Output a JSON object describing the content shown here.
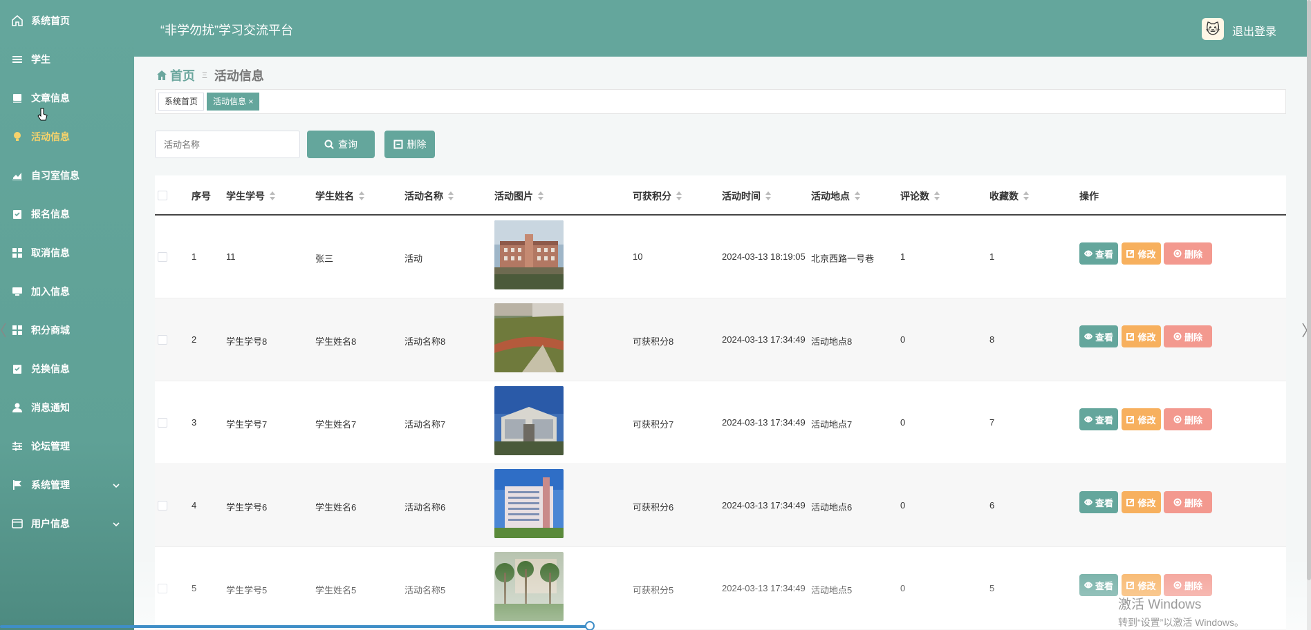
{
  "app": {
    "title": "“非学勿扰”学习交流平台",
    "logout_label": "退出登录"
  },
  "sidebar": {
    "items": [
      {
        "label": "系统首页",
        "icon": "home-icon",
        "active": false
      },
      {
        "label": "学生",
        "icon": "list-icon",
        "active": false
      },
      {
        "label": "文章信息",
        "icon": "book-icon",
        "active": false
      },
      {
        "label": "活动信息",
        "icon": "bulb-icon",
        "active": true
      },
      {
        "label": "自习室信息",
        "icon": "chart-icon",
        "active": false
      },
      {
        "label": "报名信息",
        "icon": "clipboard-icon",
        "active": false
      },
      {
        "label": "取消信息",
        "icon": "grid-icon",
        "active": false
      },
      {
        "label": "加入信息",
        "icon": "monitor-icon",
        "active": false
      },
      {
        "label": "积分商城",
        "icon": "grid-icon",
        "active": false
      },
      {
        "label": "兑换信息",
        "icon": "clipboard-icon",
        "active": false
      },
      {
        "label": "消息通知",
        "icon": "user-icon",
        "active": false
      },
      {
        "label": "论坛管理",
        "icon": "sliders-icon",
        "active": false
      },
      {
        "label": "系统管理",
        "icon": "flag-icon",
        "active": false,
        "expandable": true
      },
      {
        "label": "用户信息",
        "icon": "card-icon",
        "active": false,
        "expandable": true
      }
    ]
  },
  "breadcrumb": {
    "home": "首页",
    "current": "活动信息"
  },
  "tags": [
    {
      "label": "系统首页",
      "active": false
    },
    {
      "label": "活动信息 ×",
      "active": true
    }
  ],
  "search": {
    "placeholder": "活动名称",
    "query_label": "查询",
    "delete_label": "删除"
  },
  "table": {
    "headers": {
      "index": "序号",
      "student_no": "学生学号",
      "student_name": "学生姓名",
      "activity_name": "活动名称",
      "image": "活动图片",
      "points": "可获积分",
      "time": "活动时间",
      "location": "活动地点",
      "comments": "评论数",
      "favorites": "收藏数",
      "actions": "操作"
    },
    "rows": [
      {
        "index": "1",
        "student_no": "11",
        "student_name": "张三",
        "activity_name": "活动",
        "points": "10",
        "time": "2024-03-13 18:19:05",
        "location": "北京西路一号巷",
        "comments": "1",
        "favorites": "1",
        "image": "campus-building"
      },
      {
        "index": "2",
        "student_no": "学生学号8",
        "student_name": "学生姓名8",
        "activity_name": "活动名称8",
        "points": "可获积分8",
        "time": "2024-03-13 17:34:49",
        "location": "活动地点8",
        "comments": "0",
        "favorites": "8",
        "image": "sports-field"
      },
      {
        "index": "3",
        "student_no": "学生学号7",
        "student_name": "学生姓名7",
        "activity_name": "活动名称7",
        "points": "可获积分7",
        "time": "2024-03-13 17:34:49",
        "location": "活动地点7",
        "comments": "0",
        "favorites": "7",
        "image": "modern-building"
      },
      {
        "index": "4",
        "student_no": "学生学号6",
        "student_name": "学生姓名6",
        "activity_name": "活动名称6",
        "points": "可获积分6",
        "time": "2024-03-13 17:34:49",
        "location": "活动地点6",
        "comments": "0",
        "favorites": "6",
        "image": "tall-building"
      },
      {
        "index": "5",
        "student_no": "学生学号5",
        "student_name": "学生姓名5",
        "activity_name": "活动名称5",
        "points": "可获积分5",
        "time": "2024-03-13 17:34:49",
        "location": "活动地点5",
        "comments": "0",
        "favorites": "5",
        "image": "palm-courtyard"
      }
    ],
    "action_labels": {
      "view": "查看",
      "edit": "修改",
      "delete": "删除"
    }
  },
  "watermark": {
    "line1": "激活 Windows",
    "line2": "转到“设置”以激活 Windows。"
  },
  "colors": {
    "primary": "#64a69c",
    "active_menu": "#f7d36b",
    "edit": "#f7b05e",
    "delete": "#f3998f"
  }
}
